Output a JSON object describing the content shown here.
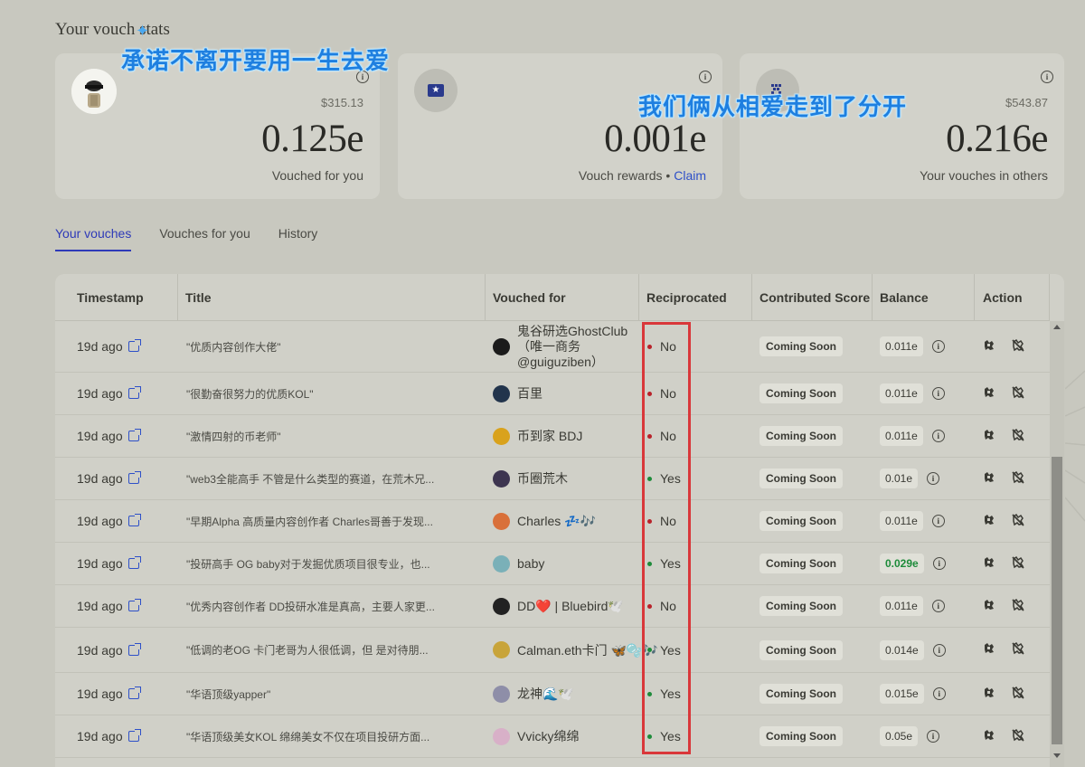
{
  "page_heading": "Your vouch stats",
  "overlays": [
    "承诺不离开要用一生去爱",
    "我们俩从相爱走到了分开"
  ],
  "cards": [
    {
      "usd": "$315.13",
      "value": "0.125e",
      "caption": "Vouched for you"
    },
    {
      "usd": "",
      "value": "0.001e",
      "caption": "Vouch rewards",
      "separator": "•",
      "link": "Claim"
    },
    {
      "usd": "$543.87",
      "value": "0.216e",
      "caption": "Your vouches in others"
    }
  ],
  "info_glyph": "i",
  "tabs": [
    "Your vouches",
    "Vouches for you",
    "History"
  ],
  "columns": [
    "Timestamp",
    "Title",
    "Vouched for",
    "Reciprocated",
    "Contributed Score",
    "Balance",
    "Action"
  ],
  "rows": [
    {
      "time": "19d ago",
      "title": "\"优质内容创作大佬\"",
      "who": "鬼谷研选GhostClub（唯一商务@guiguziben）",
      "recip": "No",
      "score": "Coming Soon",
      "balance": "0.011e",
      "avatar_color": "#1b1b1b",
      "green": false
    },
    {
      "time": "19d ago",
      "title": "\"很勤奋很努力的优质KOL\"",
      "who": "百里",
      "recip": "No",
      "score": "Coming Soon",
      "balance": "0.011e",
      "avatar_color": "#22344c",
      "green": false
    },
    {
      "time": "19d ago",
      "title": "\"激情四射的币老师\"",
      "who": "币到家 BDJ",
      "recip": "No",
      "score": "Coming Soon",
      "balance": "0.011e",
      "avatar_color": "#d9a21c",
      "green": false
    },
    {
      "time": "19d ago",
      "title": "\"web3全能高手 不管是什么类型的赛道，在荒木兄...",
      "who": "币圈荒木",
      "recip": "Yes",
      "score": "Coming Soon",
      "balance": "0.01e",
      "avatar_color": "#3d3550",
      "green": false
    },
    {
      "time": "19d ago",
      "title": "\"早期Alpha 高质量内容创作者 Charles哥善于发现...",
      "who": "Charles 💤🎶",
      "recip": "No",
      "score": "Coming Soon",
      "balance": "0.011e",
      "avatar_color": "#d9703a",
      "green": false
    },
    {
      "time": "19d ago",
      "title": "\"投研高手 OG baby对于发掘优质项目很专业，也...",
      "who": "baby",
      "recip": "Yes",
      "score": "Coming Soon",
      "balance": "0.029e",
      "avatar_color": "#7ab0b8",
      "green": true
    },
    {
      "time": "19d ago",
      "title": "\"优秀内容创作者 DD投研水准是真高，主要人家更...",
      "who": "DD❤️ | Bluebird🕊️",
      "recip": "No",
      "score": "Coming Soon",
      "balance": "0.011e",
      "avatar_color": "#222222",
      "green": false
    },
    {
      "time": "19d ago",
      "title": "\"低调的老OG 卡门老哥为人很低调，但 是对待朋...",
      "who": "Calman.eth卡门 🦋🫧🎶",
      "recip": "Yes",
      "score": "Coming Soon",
      "balance": "0.014e",
      "avatar_color": "#c8a43a",
      "green": false
    },
    {
      "time": "19d ago",
      "title": "\"华语顶级yapper\"",
      "who": "龙神🌊🕊️",
      "recip": "Yes",
      "score": "Coming Soon",
      "balance": "0.015e",
      "avatar_color": "#8e8ea8",
      "green": false
    },
    {
      "time": "19d ago",
      "title": "\"华语顶级美女KOL 绵绵美女不仅在项目投研方面...",
      "who": "Vvicky绵绵",
      "recip": "Yes",
      "score": "Coming Soon",
      "balance": "0.05e",
      "avatar_color": "#d8b0c8",
      "green": false
    }
  ],
  "colors": {
    "yes": "#1d8b3a",
    "no": "#b8222a",
    "accent": "#2e3ab8",
    "highlight": "#d9373a"
  }
}
